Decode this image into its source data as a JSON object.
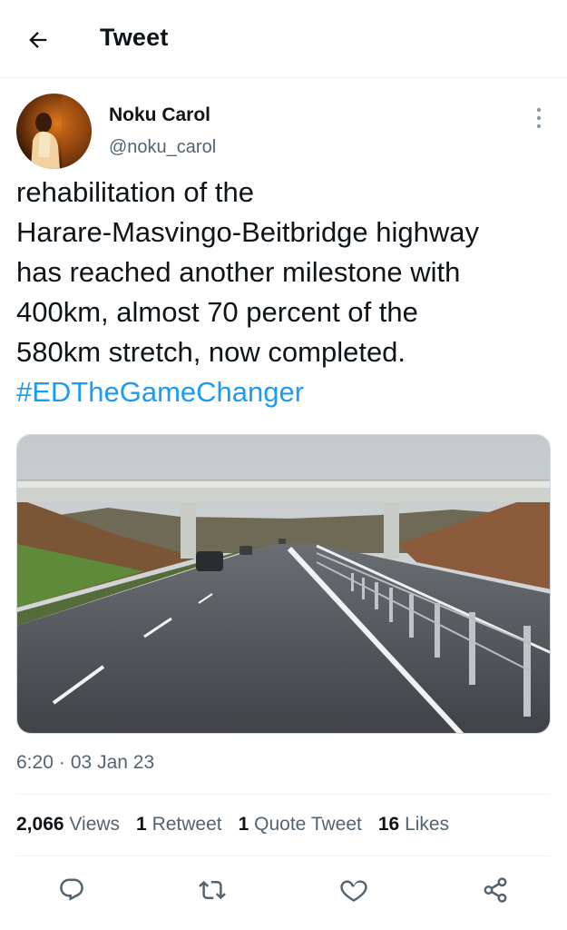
{
  "header": {
    "title": "Tweet",
    "back_icon": "arrow-left-icon"
  },
  "author": {
    "display_name": "Noku Carol",
    "handle": "@noku_carol",
    "more_icon": "more-vertical-icon"
  },
  "tweet": {
    "lines": [
      "rehabilitation of the",
      "Harare-Masvingo-Beitbridge highway",
      "has reached another milestone with",
      "400km, almost 70 percent of the",
      "580km stretch, now completed."
    ],
    "hashtag": "#EDTheGameChanger"
  },
  "meta": {
    "time": "6:20",
    "separator": "·",
    "date": "03 Jan 23"
  },
  "stats": {
    "views_count": "2,066",
    "views_label": "Views",
    "retweets_count": "1",
    "retweets_label": "Retweet",
    "quotes_count": "1",
    "quotes_label": "Quote Tweet",
    "likes_count": "16",
    "likes_label": "Likes"
  },
  "actions": [
    "reply-icon",
    "retweet-icon",
    "like-icon",
    "share-icon"
  ],
  "colors": {
    "accent": "#1d9bf0",
    "text": "#0f1419",
    "secondary": "#536471",
    "divider": "#eff3f4"
  }
}
